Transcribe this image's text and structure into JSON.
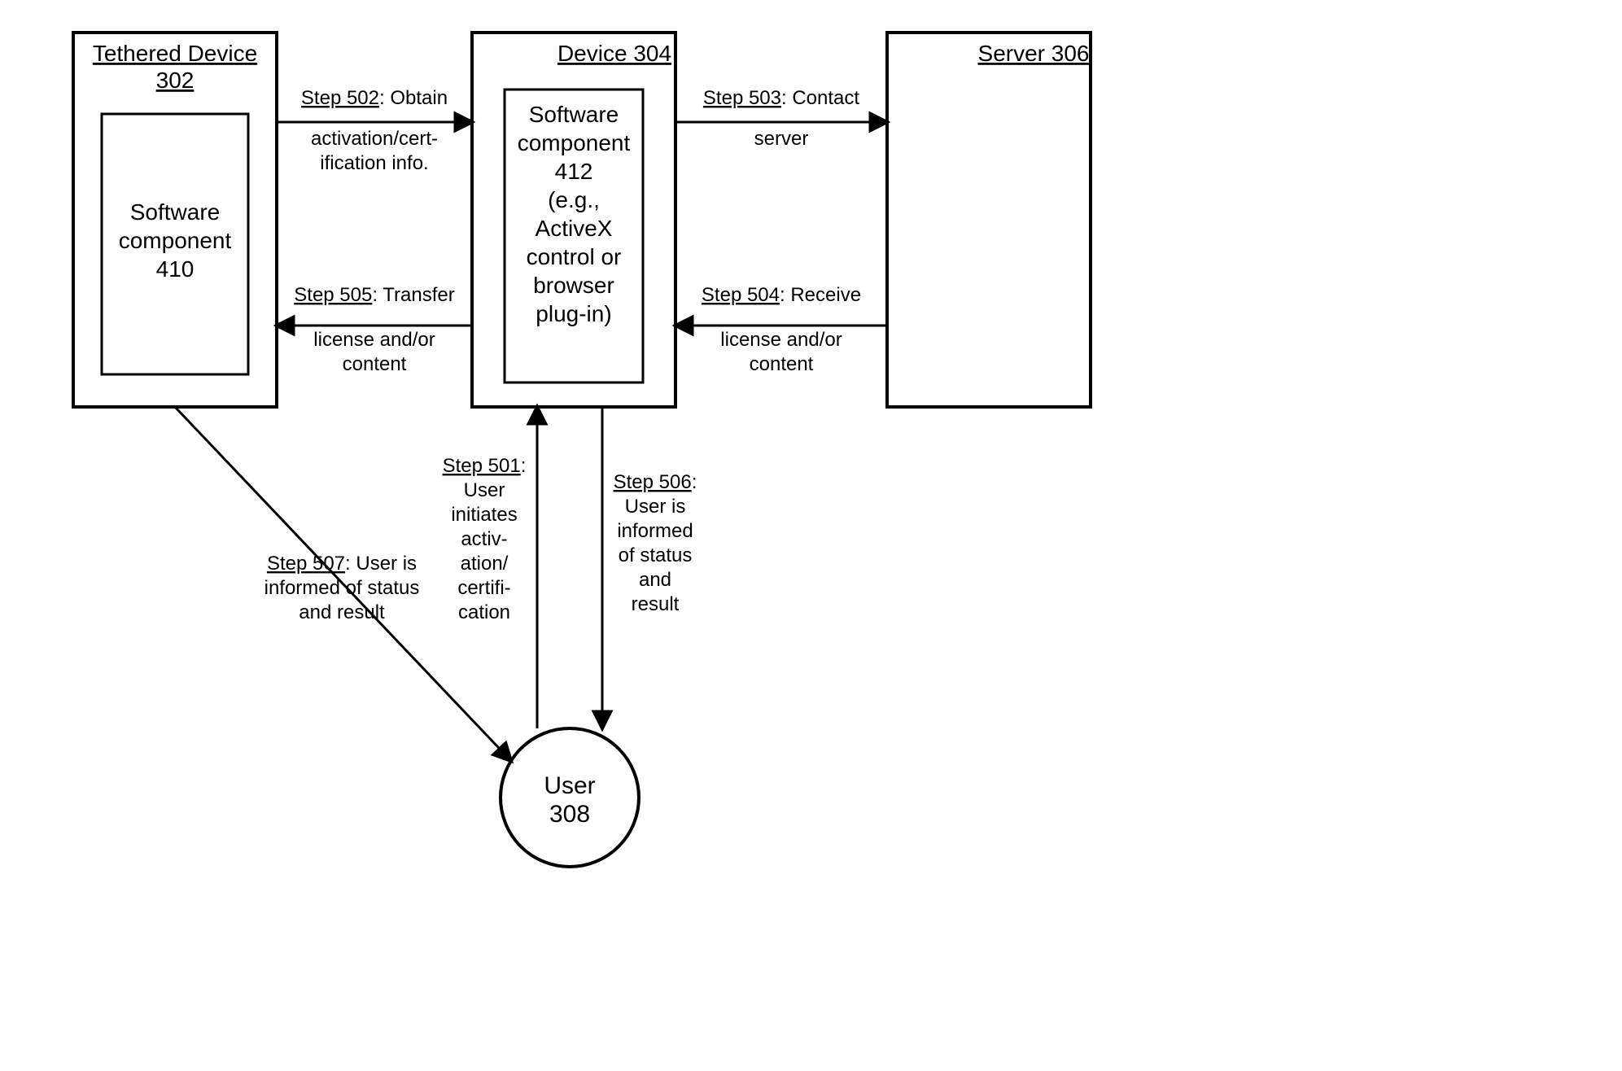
{
  "boxes": {
    "tethered": {
      "title_l1": "Tethered Device",
      "title_l2": "302",
      "component_l1": "Software",
      "component_l2": "component",
      "component_l3": "410"
    },
    "device": {
      "title": "Device 304",
      "component_l1": "Software",
      "component_l2": "component",
      "component_l3": "412",
      "component_l4": "(e.g.,",
      "component_l5": "ActiveX",
      "component_l6": "control or",
      "component_l7": "browser",
      "component_l8": "plug-in)"
    },
    "server": {
      "title": "Server 306"
    }
  },
  "user": {
    "l1": "User",
    "l2": "308"
  },
  "steps": {
    "s501_u": "Step 501",
    "s501_colon": ":",
    "s501_l2": "User",
    "s501_l3": "initiates",
    "s501_l4": "activ-",
    "s501_l5": "ation/",
    "s501_l6": "certifi-",
    "s501_l7": "cation",
    "s502_u": "Step 502",
    "s502_rest": ": Obtain",
    "s502_l2": "activation/cert-",
    "s502_l3": "ification info.",
    "s503_u": "Step 503",
    "s503_rest": ": Contact",
    "s503_l2": "server",
    "s504_u": "Step 504",
    "s504_rest": ": Receive",
    "s504_l2": "license and/or",
    "s504_l3": "content",
    "s505_u": "Step 505",
    "s505_rest": ": Transfer",
    "s505_l2": "license and/or",
    "s505_l3": "content",
    "s506_u": "Step 506",
    "s506_colon": ":",
    "s506_l2": "User is",
    "s506_l3": "informed",
    "s506_l4": "of status",
    "s506_l5": "and",
    "s506_l6": "result",
    "s507_u": "Step 507",
    "s507_rest": ": User is",
    "s507_l2": "informed of status",
    "s507_l3": "and result"
  }
}
